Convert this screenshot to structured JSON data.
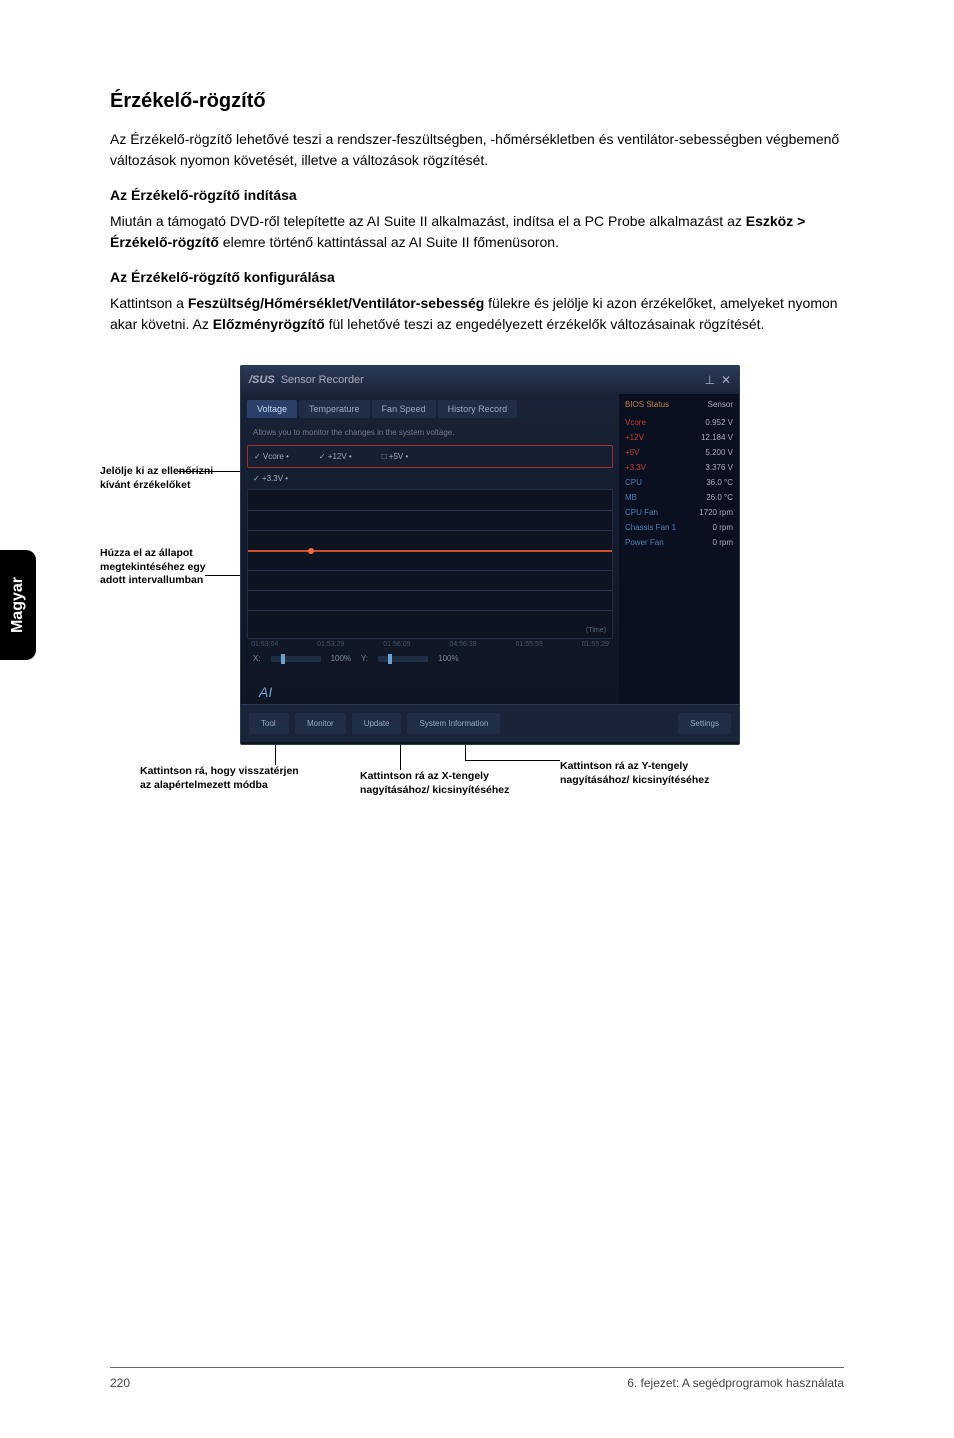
{
  "sidebar_label": "Magyar",
  "section_title": "Érzékelő-rögzítő",
  "intro_text": "Az Érzékelő-rögzítő lehetővé teszi a rendszer-feszültségben, -hőmérsékletben és ventilátor-sebességben végbemenő változások nyomon követését, illetve a változások rögzítését.",
  "sub1_title": "Az Érzékelő-rögzítő indítása",
  "sub1_text_a": "Miután a támogató DVD-ről telepítette az AI Suite II alkalmazást, indítsa el a PC Probe alkalmazást az ",
  "sub1_bold": "Eszköz > Érzékelő-rögzítő",
  "sub1_text_b": " elemre történő kattintással az AI Suite II főmenüsoron.",
  "sub2_title": "Az Érzékelő-rögzítő konfigurálása",
  "sub2_text_a": "Kattintson a ",
  "sub2_bold_a": "Feszültség/Hőmérséklet/Ventilátor-sebesség",
  "sub2_text_b": " fülekre és jelölje ki azon érzékelőket, amelyeket nyomon akar követni. Az ",
  "sub2_bold_b": "Előzményrögzítő",
  "sub2_text_c": " fül lehetővé teszi az engedélyezett érzékelők változásainak rögzítését.",
  "callouts": {
    "c1": "Jelölje ki az ellenőrizni kívánt érzékelőket",
    "c2": "Húzza el az állapot megtekintéséhez egy adott intervallumban",
    "c3_a": "Kattintson rá, hogy visszatérjen az alapértelmezett módba",
    "c4_a": "Kattintson rá az X-tengely nagyításához/ kicsinyítéséhez",
    "c5_a": "Kattintson rá az Y-tengely nagyításához/ kicsinyítéséhez"
  },
  "screenshot": {
    "title_brand": "/SUS",
    "title_text": "Sensor Recorder",
    "min_icon": "⊥",
    "close_icon": "✕",
    "tabs": [
      "Voltage",
      "Temperature",
      "Fan Speed",
      "History Record"
    ],
    "hint": "Allows you to monitor the changes in the system voltage.",
    "checks": [
      "✓ Vcore •",
      "✓ +12V •",
      "□ +5V •"
    ],
    "checks2": "✓ +3.3V •",
    "timecodes": [
      "01:53:04",
      "01:53:29",
      "01:56:09",
      "04:56:39",
      "01:55:59",
      "01:55:29"
    ],
    "slider_x_label": "X:",
    "slider_x_val": "100%",
    "slider_y_label": "Y:",
    "slider_y_val": "100%",
    "timeline_label": "(Time)",
    "bottom_buttons": [
      "Tool",
      "Monitor",
      "Update",
      "System Information"
    ],
    "bottom_right": "Settings",
    "side_title_left": "BIOS Status",
    "side_title_right": "Sensor",
    "side_items": [
      {
        "k": "Vcore",
        "v": "0.952 V",
        "cls": "k"
      },
      {
        "k": "+12V",
        "v": "12.184 V",
        "cls": "k"
      },
      {
        "k": "+5V",
        "v": "5.200 V",
        "cls": "k"
      },
      {
        "k": "+3.3V",
        "v": "3.376 V",
        "cls": "k"
      },
      {
        "k": "CPU",
        "v": "36.0 °C",
        "cls": "b"
      },
      {
        "k": "MB",
        "v": "26.0 °C",
        "cls": "b"
      },
      {
        "k": "CPU Fan",
        "v": "1720 rpm",
        "cls": "b"
      },
      {
        "k": "Chassis Fan 1",
        "v": "0 rpm",
        "cls": "b"
      },
      {
        "k": "Power Fan",
        "v": "0 rpm",
        "cls": "b"
      }
    ]
  },
  "footer": {
    "page": "220",
    "chapter": "6. fejezet: A segédprogramok használata"
  }
}
